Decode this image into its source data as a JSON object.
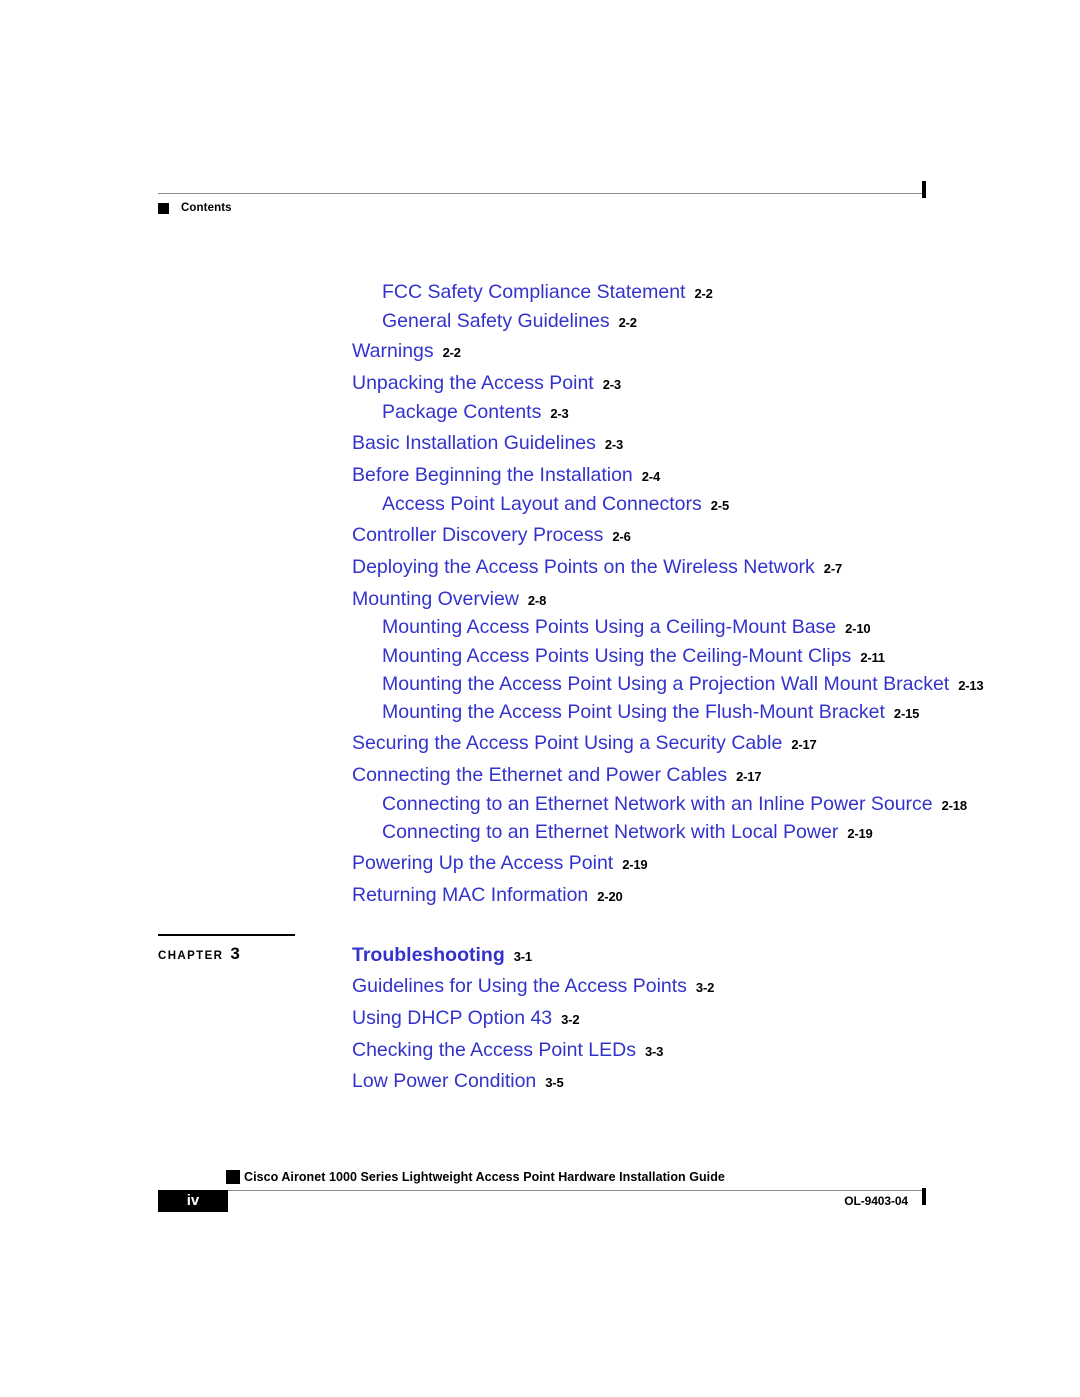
{
  "header": {
    "bullet_icon": "square-bullet-icon",
    "label": "Contents",
    "crop_mark_icon": "crop-mark-icon"
  },
  "toc": {
    "entries": [
      {
        "title": "FCC Safety Compliance Statement",
        "page": "2-2",
        "level": 2
      },
      {
        "title": "General Safety Guidelines",
        "page": "2-2",
        "level": 2
      },
      {
        "title": "Warnings",
        "page": "2-2",
        "level": 1
      },
      {
        "title": "Unpacking the Access Point",
        "page": "2-3",
        "level": 1
      },
      {
        "title": "Package Contents",
        "page": "2-3",
        "level": 2
      },
      {
        "title": "Basic Installation Guidelines",
        "page": "2-3",
        "level": 1
      },
      {
        "title": "Before Beginning the Installation",
        "page": "2-4",
        "level": 1
      },
      {
        "title": "Access Point Layout and Connectors",
        "page": "2-5",
        "level": 2
      },
      {
        "title": "Controller Discovery Process",
        "page": "2-6",
        "level": 1
      },
      {
        "title": "Deploying the Access Points on the Wireless Network",
        "page": "2-7",
        "level": 1
      },
      {
        "title": "Mounting Overview",
        "page": "2-8",
        "level": 1
      },
      {
        "title": "Mounting Access Points Using a Ceiling-Mount Base",
        "page": "2-10",
        "level": 2
      },
      {
        "title": "Mounting Access Points Using the Ceiling-Mount Clips",
        "page": "2-11",
        "level": 2
      },
      {
        "title": "Mounting the Access Point Using a Projection Wall Mount Bracket",
        "page": "2-13",
        "level": 2
      },
      {
        "title": "Mounting the Access Point Using the Flush-Mount Bracket",
        "page": "2-15",
        "level": 2
      },
      {
        "title": "Securing the Access Point Using a Security Cable",
        "page": "2-17",
        "level": 1
      },
      {
        "title": "Connecting the Ethernet and Power Cables",
        "page": "2-17",
        "level": 1
      },
      {
        "title": "Connecting to an Ethernet Network with an Inline Power Source",
        "page": "2-18",
        "level": 2
      },
      {
        "title": "Connecting to an Ethernet Network with Local Power",
        "page": "2-19",
        "level": 2
      },
      {
        "title": "Powering Up the Access Point",
        "page": "2-19",
        "level": 1
      },
      {
        "title": "Returning MAC Information",
        "page": "2-20",
        "level": 1
      },
      {
        "title": "Troubleshooting",
        "page": "3-1",
        "level": 0
      },
      {
        "title": "Guidelines for Using the Access Points",
        "page": "3-2",
        "level": 1
      },
      {
        "title": "Using DHCP Option 43",
        "page": "3-2",
        "level": 1
      },
      {
        "title": "Checking the Access Point LEDs",
        "page": "3-3",
        "level": 1
      },
      {
        "title": "Low Power Condition",
        "page": "3-5",
        "level": 1
      }
    ]
  },
  "chapter_marker": {
    "word": "CHAPTER",
    "number": "3"
  },
  "footer": {
    "page_number": "iv",
    "bullet_icon": "square-bullet-icon",
    "document_title": "Cisco Aironet 1000 Series Lightweight Access Point Hardware Installation Guide",
    "document_id": "OL-9403-04",
    "crop_mark_icon": "crop-mark-icon"
  },
  "colors": {
    "link_blue": "#3333cc",
    "rule_gray": "#8c8c8c",
    "text_black": "#000000"
  }
}
